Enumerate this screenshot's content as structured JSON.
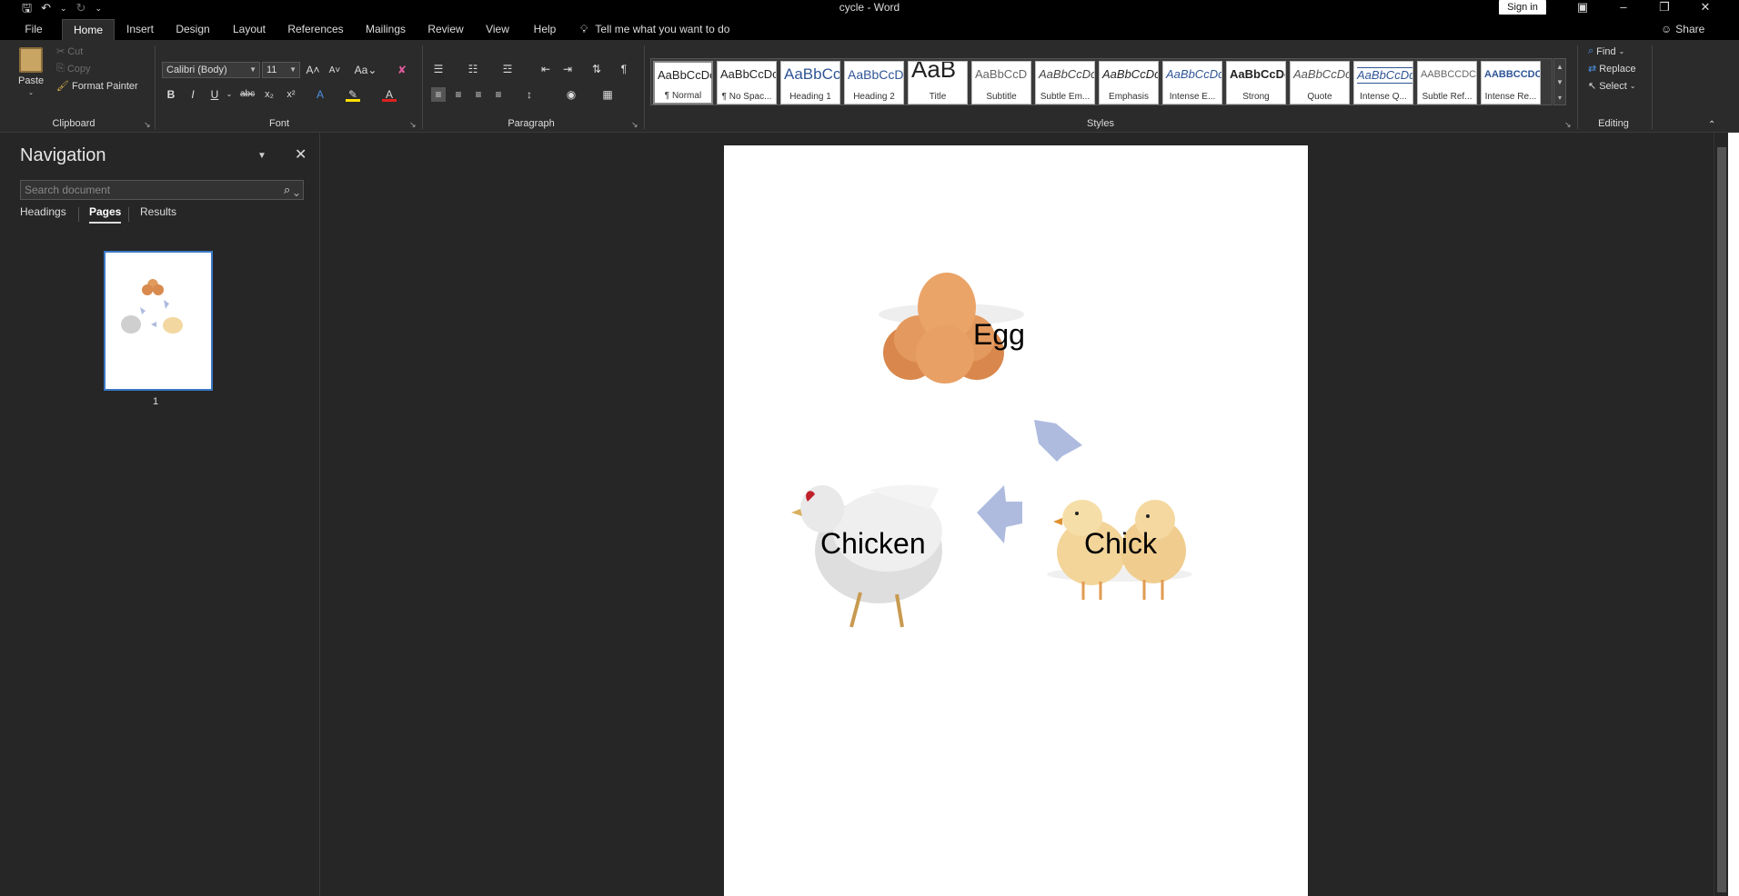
{
  "window": {
    "title": "cycle - Word",
    "sign_in": "Sign in",
    "share": "Share"
  },
  "qat": {
    "save_icon": "save-icon",
    "undo_icon": "undo-icon",
    "redo_icon": "redo-icon"
  },
  "tabs": [
    "File",
    "Home",
    "Insert",
    "Design",
    "Layout",
    "References",
    "Mailings",
    "Review",
    "View",
    "Help"
  ],
  "active_tab": "Home",
  "tell_me": "Tell me what you want to do",
  "clipboard": {
    "paste": "Paste",
    "cut": "Cut",
    "copy": "Copy",
    "format_painter": "Format Painter",
    "label": "Clipboard"
  },
  "font": {
    "name": "Calibri (Body)",
    "size": "11",
    "label": "Font",
    "case": "Aa"
  },
  "paragraph": {
    "label": "Paragraph"
  },
  "styles": {
    "label": "Styles",
    "items": [
      {
        "preview": "AaBbCcDc",
        "name": "¶ Normal"
      },
      {
        "preview": "AaBbCcDc",
        "name": "¶ No Spac..."
      },
      {
        "preview": "AaBbCc",
        "name": "Heading 1"
      },
      {
        "preview": "AaBbCcD",
        "name": "Heading 2"
      },
      {
        "preview": "AaB",
        "name": "Title"
      },
      {
        "preview": "AaBbCcD",
        "name": "Subtitle"
      },
      {
        "preview": "AaBbCcDc",
        "name": "Subtle Em..."
      },
      {
        "preview": "AaBbCcDc",
        "name": "Emphasis"
      },
      {
        "preview": "AaBbCcDc",
        "name": "Intense E..."
      },
      {
        "preview": "AaBbCcDc",
        "name": "Strong"
      },
      {
        "preview": "AaBbCcDc",
        "name": "Quote"
      },
      {
        "preview": "AaBbCcDc",
        "name": "Intense Q..."
      },
      {
        "preview": "AABBCCDC",
        "name": "Subtle Ref..."
      },
      {
        "preview": "AABBCCDC",
        "name": "Intense Re..."
      }
    ]
  },
  "editing": {
    "find": "Find",
    "replace": "Replace",
    "select": "Select",
    "label": "Editing"
  },
  "navigation": {
    "title": "Navigation",
    "search_placeholder": "Search document",
    "tabs": [
      "Headings",
      "Pages",
      "Results"
    ],
    "active_tab": "Pages",
    "page_number": "1"
  },
  "document": {
    "labels": {
      "egg": "Egg",
      "chick": "Chick",
      "chicken": "Chicken"
    },
    "arrow_color": "#aebbdf"
  }
}
